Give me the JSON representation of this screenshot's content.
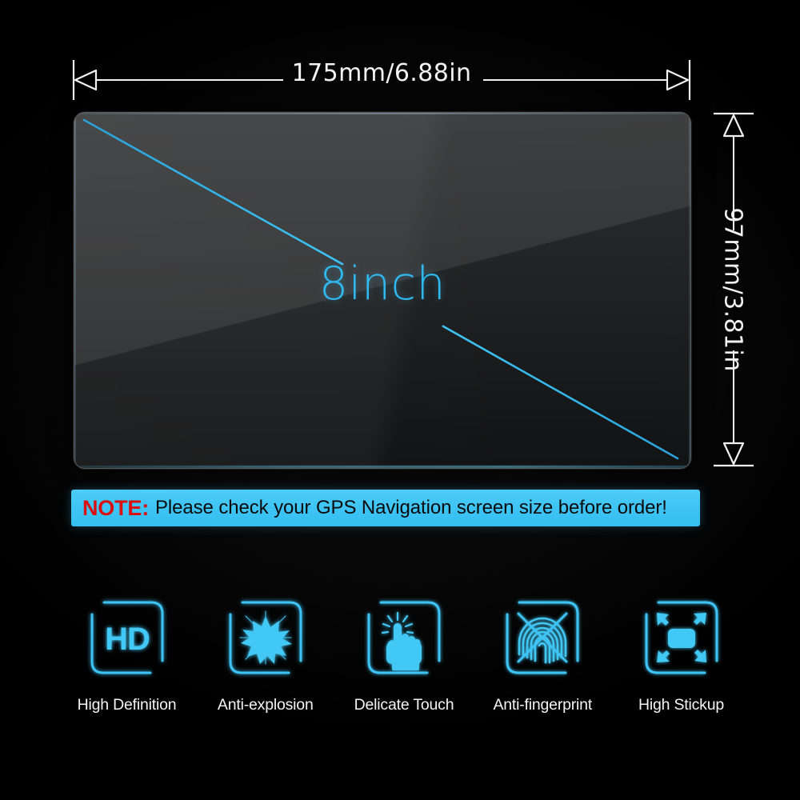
{
  "product": {
    "type": "tempered-glass-screen-protector-infographic",
    "screen_size_label": "8inch"
  },
  "dimensions": {
    "width_label": "175mm/6.88in",
    "height_label": "97mm/3.81in"
  },
  "note": {
    "tag": "NOTE:",
    "message": "Please check your GPS Navigation screen size before order!"
  },
  "features": [
    {
      "label": "High Definition",
      "icon": "hd-icon",
      "icon_text": "HD"
    },
    {
      "label": "Anti-explosion",
      "icon": "explosion-icon",
      "icon_text": ""
    },
    {
      "label": "Delicate Touch",
      "icon": "touch-hand-icon",
      "icon_text": ""
    },
    {
      "label": "Anti-fingerprint",
      "icon": "fingerprint-crossed-icon",
      "icon_text": ""
    },
    {
      "label": "High Stickup",
      "icon": "expand-arrows-icon",
      "icon_text": ""
    }
  ],
  "colors": {
    "background": "#000000",
    "accent_cyan": "#3ec4f4",
    "icon_cyan": "#42c8f5",
    "glass_line_cyan": "#2fa8e0",
    "note_red": "#d9100f",
    "note_banner_bg": "#3ec4f4",
    "dimension_line": "#f2f2f2",
    "label_text": "#f4f4f4"
  }
}
